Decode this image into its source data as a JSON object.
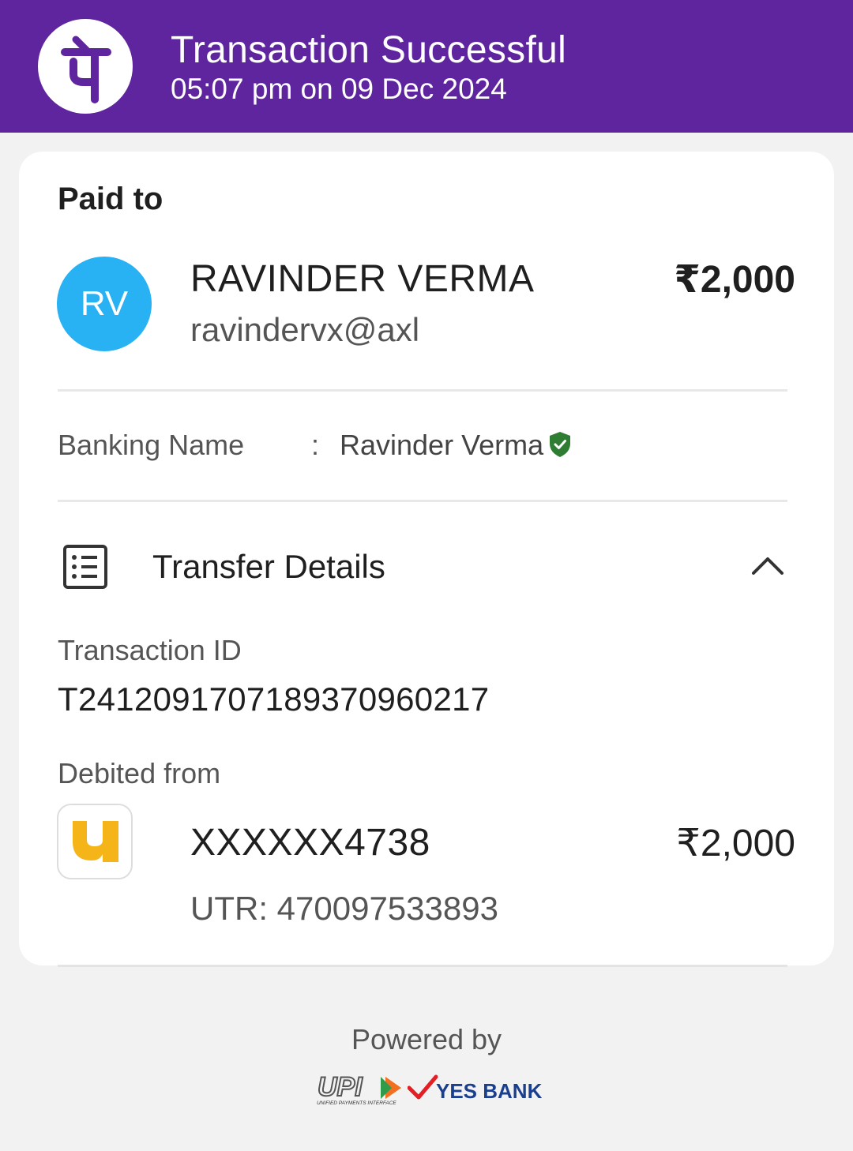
{
  "header": {
    "title": "Transaction Successful",
    "datetime": "05:07 pm on 09 Dec 2024",
    "logo_icon": "phonepe-logo-icon",
    "brand_color": "#5f259f"
  },
  "payment": {
    "section_label": "Paid to",
    "avatar_initials": "RV",
    "avatar_color": "#28b2f4",
    "payee_name": "RAVINDER VERMA",
    "payee_upi": "ravindervx@axl",
    "amount": "₹2,000"
  },
  "banking": {
    "label": "Banking Name",
    "separator": ":",
    "value": "Ravinder Verma",
    "verified_icon": "verified-shield-icon",
    "verified_color": "#2e7d32"
  },
  "transfer_details": {
    "title": "Transfer Details",
    "icon": "receipt-list-icon",
    "toggle_icon": "chevron-up-icon",
    "transaction_id_label": "Transaction ID",
    "transaction_id": "T2412091707189370960217",
    "debited_from_label": "Debited from",
    "bank_logo_icon": "pnb-bank-logo-icon",
    "account_number": "XXXXXX4738",
    "utr": "UTR: 470097533893",
    "amount": "₹2,000"
  },
  "footer": {
    "powered_by": "Powered by",
    "upi_logo_text": "UPI",
    "upi_logo_subtext": "UNIFIED PAYMENTS INTERFACE",
    "partner_bank": "YES BANK"
  }
}
